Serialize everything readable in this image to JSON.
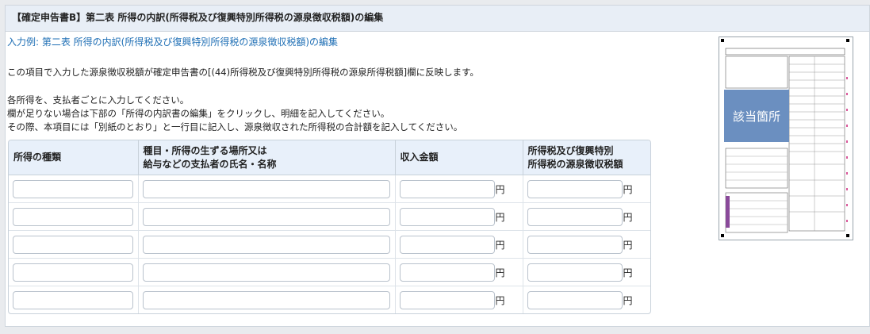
{
  "header": {
    "title": "【確定申告書B】第二表 所得の内訳(所得税及び復興特別所得税の源泉徴収税額)の編集"
  },
  "example_link": "入力例: 第二表 所得の内訳(所得税及び復興特別所得税の源泉徴収税額)の編集",
  "descriptions": {
    "line1": "この項目で入力した源泉徴収税額が確定申告書の[(44)所得税及び復興特別所得税の源泉所得税額]欄に反映します。",
    "line2": "各所得を、支払者ごとに入力してください。",
    "line3": "欄が足りない場合は下部の「所得の内訳書の編集」をクリックし、明細を記入してください。",
    "line4": "その際、本項目には「別紙のとおり」と一行目に記入し、源泉徴収された所得税の合計額を記入してください。"
  },
  "table": {
    "headers": {
      "type": "所得の種類",
      "place_line1": "種目・所得の生ずる場所又は",
      "place_line2": "給与などの支払者の氏名・名称",
      "income": "収入金額",
      "tax_line1": "所得税及び復興特別",
      "tax_line2": "所得税の源泉徴収税額"
    },
    "unit": "円",
    "rows": [
      {
        "type": "",
        "place": "",
        "income": "",
        "tax": ""
      },
      {
        "type": "",
        "place": "",
        "income": "",
        "tax": ""
      },
      {
        "type": "",
        "place": "",
        "income": "",
        "tax": ""
      },
      {
        "type": "",
        "place": "",
        "income": "",
        "tax": ""
      },
      {
        "type": "",
        "place": "",
        "income": "",
        "tax": ""
      }
    ]
  },
  "thumbnail": {
    "highlight_label": "該当箇所"
  },
  "colors": {
    "link": "#1f6fb5",
    "header_bg": "#e8eef6",
    "highlight": "#6b8fc0"
  }
}
